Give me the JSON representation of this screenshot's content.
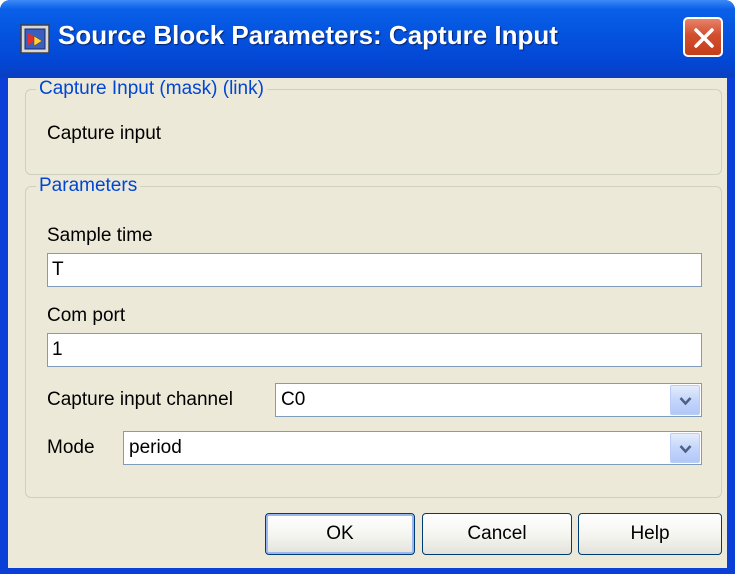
{
  "window": {
    "title": "Source Block Parameters: Capture Input"
  },
  "description_group": {
    "legend": "Capture Input (mask) (link)",
    "text": "Capture input"
  },
  "parameters_group": {
    "legend": "Parameters",
    "sample_time": {
      "label": "Sample time",
      "value": "T"
    },
    "com_port": {
      "label": "Com port",
      "value": "1"
    },
    "capture_channel": {
      "label": "Capture input channel",
      "value": "C0"
    },
    "mode": {
      "label": "Mode",
      "value": "period"
    }
  },
  "buttons": {
    "ok": "OK",
    "cancel": "Cancel",
    "help": "Help"
  },
  "colors": {
    "titlebar": "#0455e0",
    "dialog_bg": "#ece9d8",
    "group_legend": "#0046d5",
    "close_button": "#d24f2e"
  },
  "icons": {
    "app": "simulink-block-icon",
    "close": "close-icon",
    "dropdown": "chevron-down-icon"
  }
}
